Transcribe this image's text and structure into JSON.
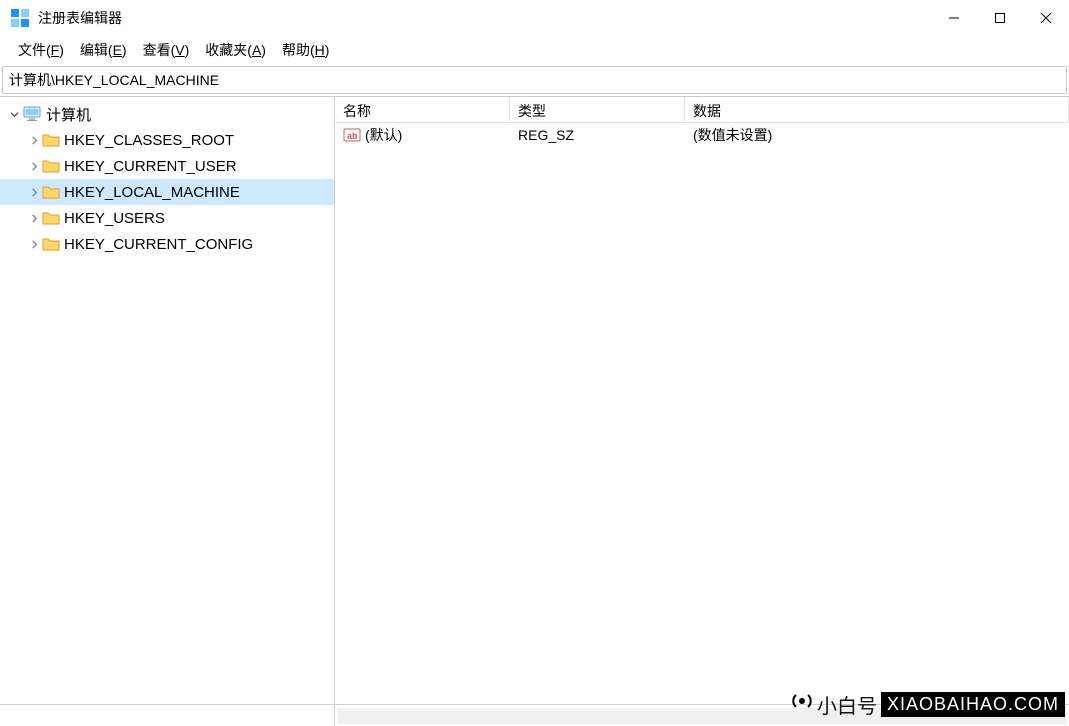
{
  "window": {
    "title": "注册表编辑器"
  },
  "menu": {
    "file": "文件(F)",
    "file_u": "F",
    "edit": "编辑(E)",
    "edit_u": "E",
    "view": "查看(V)",
    "view_u": "V",
    "fav": "收藏夹(A)",
    "fav_u": "A",
    "help": "帮助(H)",
    "help_u": "H"
  },
  "address": "计算机\\HKEY_LOCAL_MACHINE",
  "tree": {
    "root": "计算机",
    "items": [
      {
        "label": "HKEY_CLASSES_ROOT"
      },
      {
        "label": "HKEY_CURRENT_USER"
      },
      {
        "label": "HKEY_LOCAL_MACHINE",
        "selected": true
      },
      {
        "label": "HKEY_USERS"
      },
      {
        "label": "HKEY_CURRENT_CONFIG"
      }
    ]
  },
  "list": {
    "headers": {
      "name": "名称",
      "type": "类型",
      "data": "数据"
    },
    "rows": [
      {
        "name": "(默认)",
        "type": "REG_SZ",
        "data": "(数值未设置)"
      }
    ]
  },
  "watermark": {
    "cn": "小白号",
    "en": "XIAOBAIHAO.COM"
  }
}
